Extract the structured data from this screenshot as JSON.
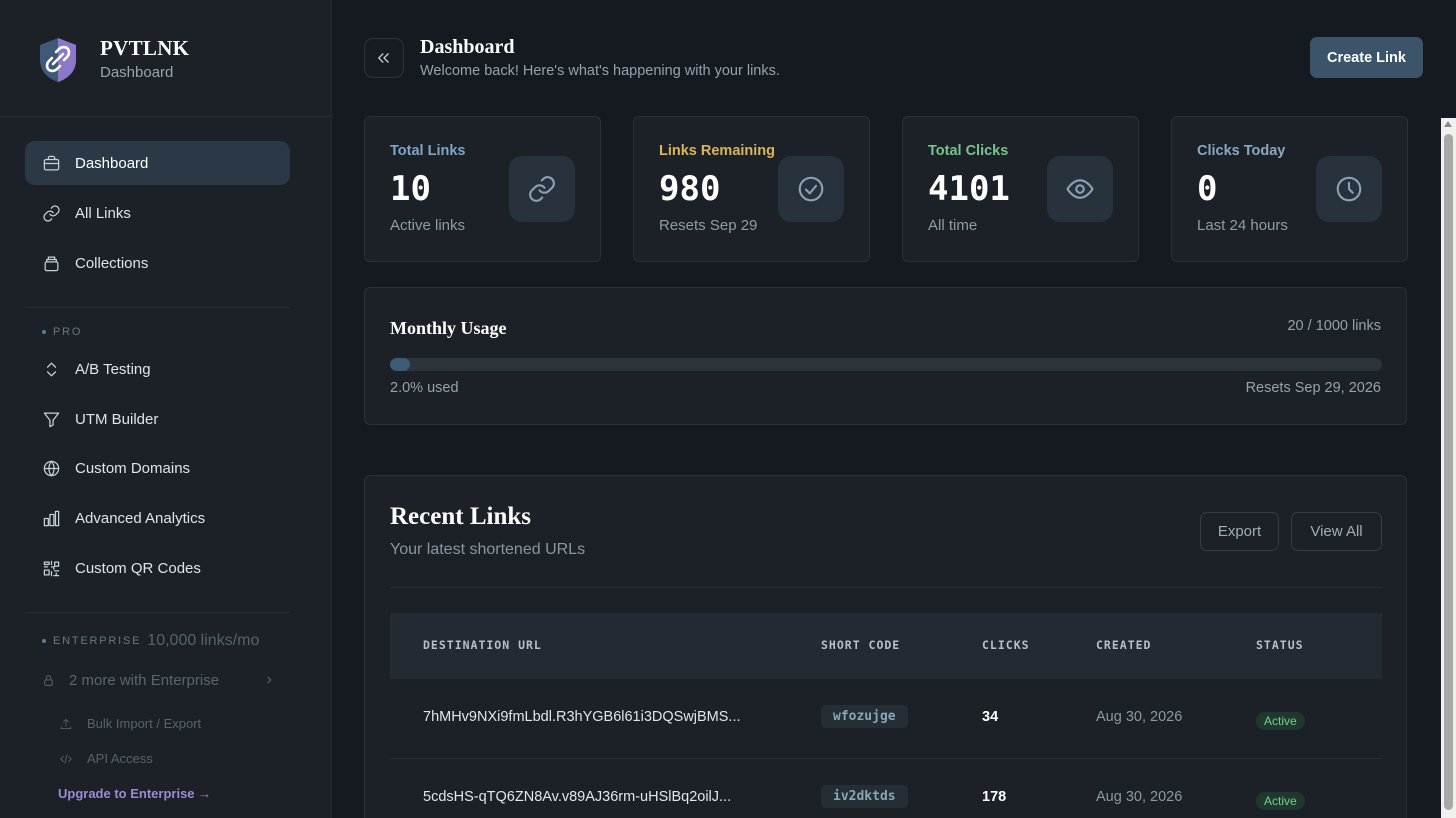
{
  "brand": {
    "name": "PVTLNK",
    "subtitle": "Dashboard"
  },
  "sidebar": {
    "items": [
      {
        "label": "Dashboard",
        "icon": "briefcase-icon",
        "active": true
      },
      {
        "label": "All Links",
        "icon": "link-icon"
      },
      {
        "label": "Collections",
        "icon": "layers-icon"
      }
    ],
    "pro_label": "PRO",
    "pro_items": [
      {
        "label": "A/B Testing",
        "icon": "chevrons-up-down-icon"
      },
      {
        "label": "UTM Builder",
        "icon": "filter-icon"
      },
      {
        "label": "Custom Domains",
        "icon": "globe-icon"
      },
      {
        "label": "Advanced Analytics",
        "icon": "bar-chart-icon"
      },
      {
        "label": "Custom QR Codes",
        "icon": "qr-code-icon"
      }
    ],
    "enterprise_label": "ENTERPRISE",
    "enterprise_extra": "10,000 links/mo",
    "enterprise_more": "2 more with Enterprise",
    "enterprise_sub": [
      {
        "label": "Bulk Import / Export",
        "icon": "upload-icon"
      },
      {
        "label": "API Access",
        "icon": "code-icon"
      }
    ],
    "upgrade": "Upgrade to Enterprise →"
  },
  "header": {
    "title": "Dashboard",
    "subtitle": "Welcome back! Here's what's happening with your links.",
    "create_label": "Create Link"
  },
  "stats": [
    {
      "label": "Total Links",
      "value": "10",
      "note": "Active links",
      "color": "#7fa6c4",
      "icon": "link-icon"
    },
    {
      "label": "Links Remaining",
      "value": "980",
      "note": "Resets Sep 29",
      "color": "#d9b65a",
      "icon": "check-circle-icon"
    },
    {
      "label": "Total Clicks",
      "value": "4101",
      "note": "All time",
      "color": "#78c48f",
      "icon": "eye-icon"
    },
    {
      "label": "Clicks Today",
      "value": "0",
      "note": "Last 24 hours",
      "color": "#8aa8c2",
      "icon": "clock-icon"
    }
  ],
  "usage": {
    "title": "Monthly Usage",
    "count": "20 / 1000 links",
    "fraction": 0.02,
    "percent_label": "2.0% used",
    "reset": "Resets Sep 29, 2026"
  },
  "recent": {
    "title": "Recent Links",
    "subtitle": "Your latest shortened URLs",
    "export_label": "Export",
    "view_all_label": "View All",
    "columns": [
      "DESTINATION URL",
      "SHORT CODE",
      "CLICKS",
      "CREATED",
      "STATUS"
    ],
    "rows": [
      {
        "url": "7hMHv9NXi9fmLbdl.R3hYGB6l61i3DQSwjBMS...",
        "code": "wfozujge",
        "clicks": "34",
        "created": "Aug 30, 2026",
        "status": "Active"
      },
      {
        "url": "5cdsHS-qTQ6ZN8Av.v89AJ36rm-uHSlBq2oilJ...",
        "code": "iv2dktds",
        "clicks": "178",
        "created": "Aug 30, 2026",
        "status": "Active"
      }
    ]
  }
}
